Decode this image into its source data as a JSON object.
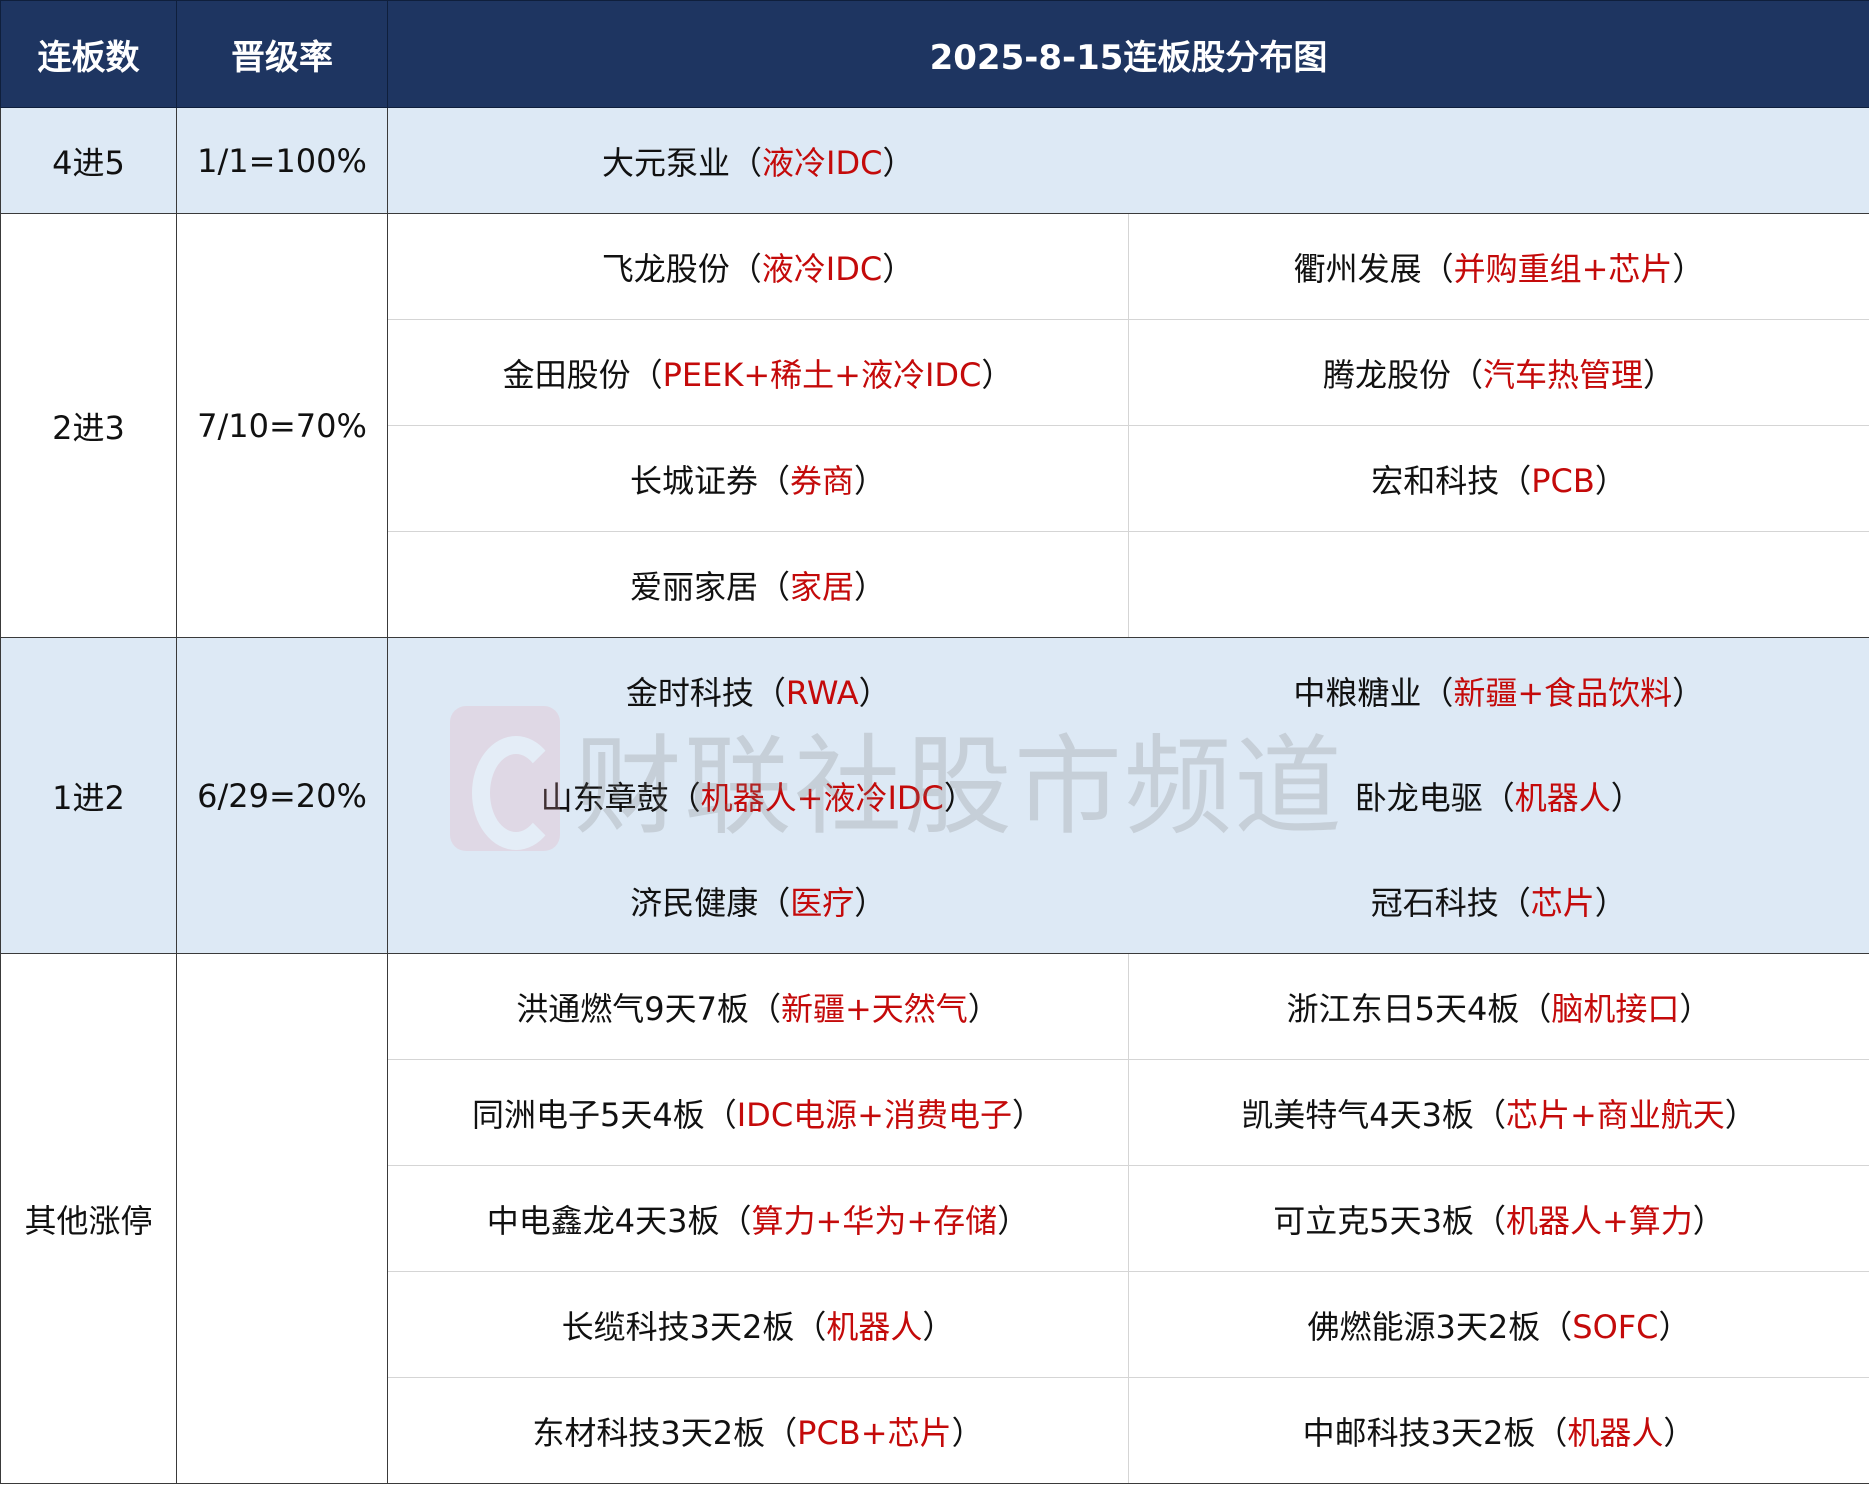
{
  "header": {
    "col_level": "连板数",
    "col_rate": "晋级率",
    "title": "2025-8-15连板股分布图"
  },
  "groups": {
    "g4": {
      "level": "4进5",
      "rate": "1/1=100%",
      "stocks": [
        {
          "name": "大元泵业",
          "open": "（",
          "tag": "液冷IDC",
          "close": "）"
        }
      ]
    },
    "g2": {
      "level": "2进3",
      "rate": "7/10=70%",
      "stocks": [
        {
          "name": "飞龙股份",
          "open": "（",
          "tag": "液冷IDC",
          "close": "）"
        },
        {
          "name": "衢州发展",
          "open": "（",
          "tag": "并购重组+芯片",
          "close": "）"
        },
        {
          "name": "金田股份",
          "open": "（",
          "tag": "PEEK+稀土+液冷IDC",
          "close": "）"
        },
        {
          "name": "腾龙股份",
          "open": "（",
          "tag": "汽车热管理",
          "close": "）"
        },
        {
          "name": "长城证券",
          "open": "（",
          "tag": "券商",
          "close": "）"
        },
        {
          "name": "宏和科技",
          "open": "（",
          "tag": "PCB",
          "close": "）"
        },
        {
          "name": "爱丽家居",
          "open": "（",
          "tag": "家居",
          "close": "）"
        }
      ]
    },
    "g1": {
      "level": "1进2",
      "rate": "6/29=20%",
      "stocks": [
        {
          "name": "金时科技",
          "open": "（",
          "tag": "RWA",
          "close": "）"
        },
        {
          "name": "中粮糖业",
          "open": "（",
          "tag": "新疆+食品饮料",
          "close": "）"
        },
        {
          "name": "山东章鼓",
          "open": "（",
          "tag": "机器人+液冷IDC",
          "close": "）"
        },
        {
          "name": "卧龙电驱",
          "open": "（",
          "tag": "机器人",
          "close": "）"
        },
        {
          "name": "济民健康",
          "open": "（",
          "tag": "医疗",
          "close": "）"
        },
        {
          "name": "冠石科技",
          "open": "（",
          "tag": "芯片",
          "close": "）"
        }
      ]
    },
    "other": {
      "level": "其他涨停",
      "rate": "",
      "stocks": [
        {
          "name": "洪通燃气9天7板",
          "open": "（",
          "tag": "新疆+天然气",
          "close": "）"
        },
        {
          "name": "浙江东日5天4板",
          "open": "（",
          "tag": "脑机接口",
          "close": "）"
        },
        {
          "name": "同洲电子5天4板",
          "open": "（",
          "tag": "IDC电源+消费电子",
          "close": "）"
        },
        {
          "name": "凯美特气4天3板",
          "open": "（",
          "tag": "芯片+商业航天",
          "close": "）"
        },
        {
          "name": "中电鑫龙4天3板",
          "open": "（",
          "tag": "算力+华为+存储",
          "close": "）"
        },
        {
          "name": "可立克5天3板",
          "open": "（",
          "tag": "机器人+算力",
          "close": "）"
        },
        {
          "name": "长缆科技3天2板",
          "open": "（",
          "tag": "机器人",
          "close": "）"
        },
        {
          "name": "佛燃能源3天2板",
          "open": "（",
          "tag": "SOFC",
          "close": "）"
        },
        {
          "name": "东材科技3天2板",
          "open": "（",
          "tag": "PCB+芯片",
          "close": "）"
        },
        {
          "name": "中邮科技3天2板",
          "open": "（",
          "tag": "机器人",
          "close": "）"
        }
      ]
    }
  },
  "watermark": {
    "text": "财联社股市频道",
    "logo_icon": "cls-logo-icon",
    "logo_color": "#e8a0ae"
  },
  "colors": {
    "header_bg": "#1e3561",
    "band_bg": "#dde9f5",
    "tag_red": "#c40a0a"
  }
}
